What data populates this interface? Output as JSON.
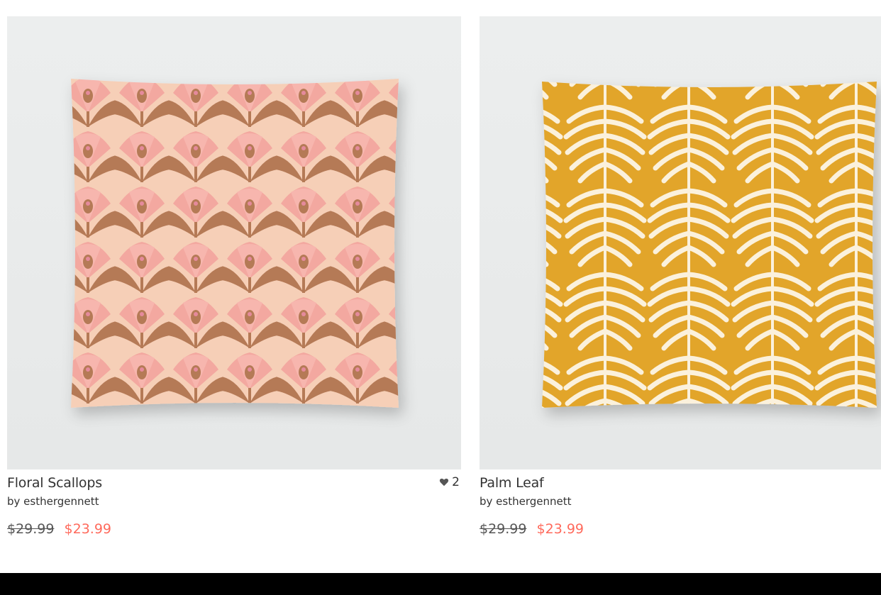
{
  "products": [
    {
      "title": "Floral Scallops",
      "author": "by esthergennett",
      "old_price": "$29.99",
      "new_price": "$23.99",
      "likes": "2",
      "image_icon": "pillow-floral-scallops-image"
    },
    {
      "title": "Palm Leaf",
      "author": "by esthergennett",
      "old_price": "$29.99",
      "new_price": "$23.99",
      "image_icon": "pillow-palm-leaf-image"
    }
  ],
  "colors": {
    "sale_price": "#ff6a5c",
    "text": "#333333",
    "pink_pillow": "#f4b3a9",
    "brown_scallop": "#b57a56",
    "mustard_pillow": "#e2a52a",
    "cream_leaf": "#fbf1dc"
  }
}
